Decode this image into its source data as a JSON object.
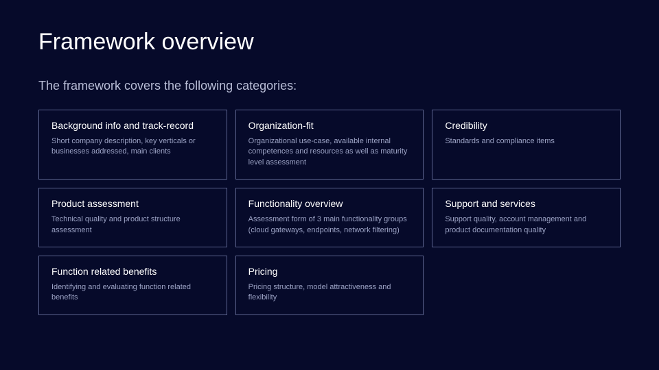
{
  "title": "Framework overview",
  "subtitle": "The framework covers the following categories:",
  "cards": [
    {
      "title": "Background info and track-record",
      "desc": "Short company description, key verticals or businesses addressed, main clients"
    },
    {
      "title": "Organization-fit",
      "desc": "Organizational use-case, available internal competences and resources as well as maturity level assessment"
    },
    {
      "title": "Credibility",
      "desc": "Standards and compliance items"
    },
    {
      "title": "Product assessment",
      "desc": "Technical quality and product structure assessment"
    },
    {
      "title": "Functionality overview",
      "desc": "Assessment form of 3 main functionality groups (cloud gateways, endpoints, network filtering)"
    },
    {
      "title": "Support and services",
      "desc": "Support quality, account management and product documentation quality"
    },
    {
      "title": "Function related benefits",
      "desc": "Identifying and evaluating function related benefits"
    },
    {
      "title": "Pricing",
      "desc": "Pricing structure, model attractiveness and flexibility"
    }
  ]
}
